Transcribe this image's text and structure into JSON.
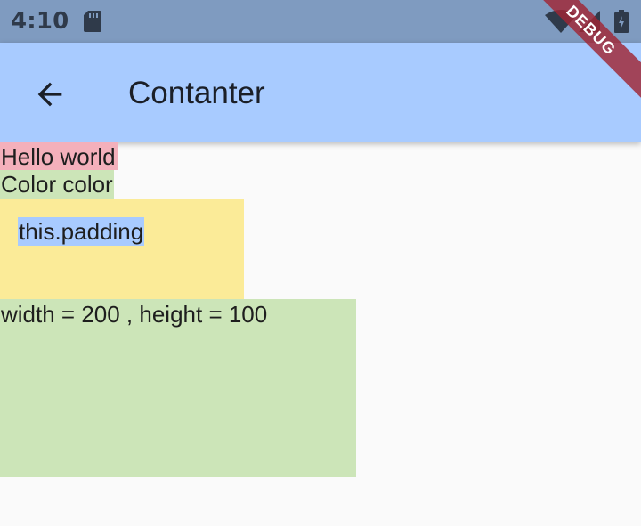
{
  "status_bar": {
    "time": "4:10",
    "icons": [
      "sd-card-icon",
      "wifi-icon",
      "signal-icon",
      "battery-icon"
    ]
  },
  "app_bar": {
    "back_icon": "arrow-back-icon",
    "title": "Contanter",
    "background": "#a8cbff"
  },
  "debug_ribbon": {
    "label": "DEBUG",
    "color": "#a02634"
  },
  "content": {
    "hello_text": "Hello world",
    "hello_bg": "#f4b0bb",
    "color_text": "Color color",
    "color_bg": "#cce5b8",
    "padding_text": "this.padding",
    "padding_box_bg": "#fbeb98",
    "padding_text_bg": "#a8cbff",
    "size_text": "width = 200 , height = 100",
    "size_box_bg": "#cce5b8"
  }
}
